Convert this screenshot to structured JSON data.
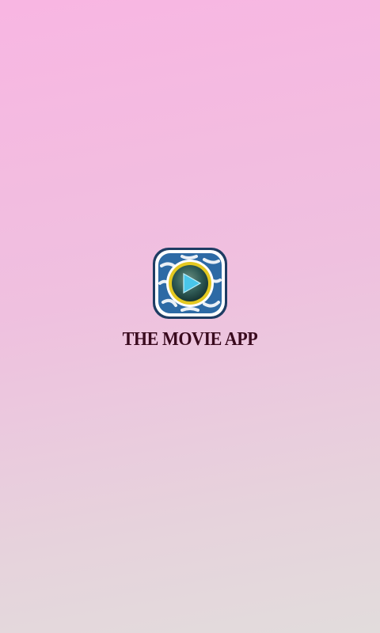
{
  "app": {
    "title": "THE MOVIE APP",
    "title_color": "#3a0a1e"
  },
  "icon": {
    "name": "movie-play-icon",
    "frame_color": "#2d6aa5",
    "tile_color": "#ffffff",
    "lens_ring_color": "#e4c820",
    "play_color": "#49c6ea"
  }
}
